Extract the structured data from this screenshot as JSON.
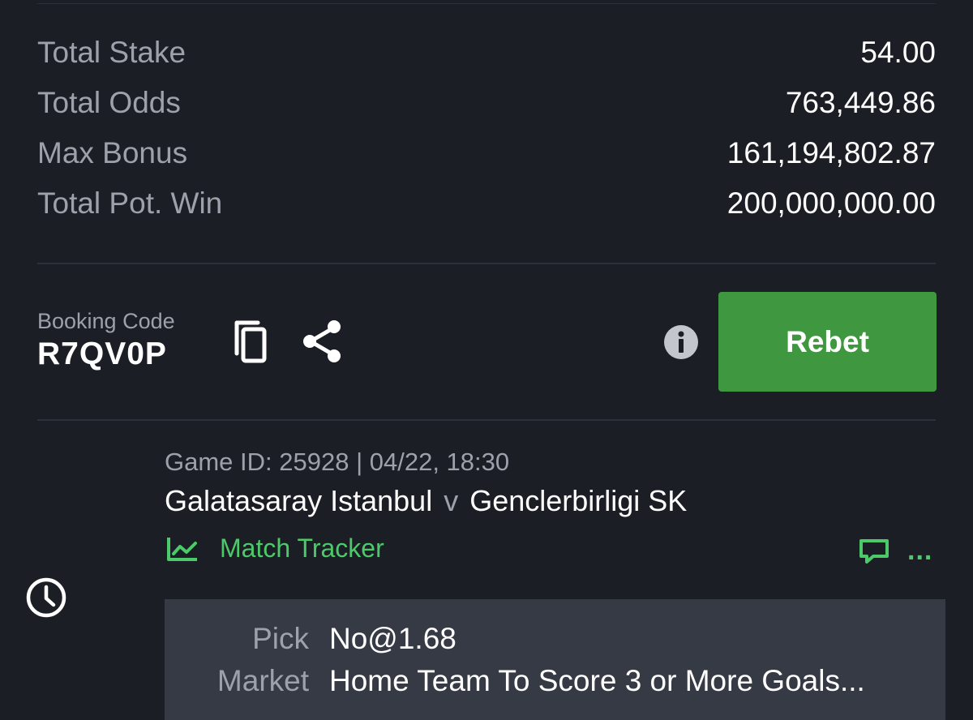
{
  "summary": {
    "rows": [
      {
        "label": "Total Stake",
        "value": "54.00"
      },
      {
        "label": "Total Odds",
        "value": "763,449.86"
      },
      {
        "label": "Max Bonus",
        "value": "161,194,802.87"
      },
      {
        "label": "Total Pot. Win",
        "value": "200,000,000.00"
      }
    ]
  },
  "booking": {
    "label": "Booking Code",
    "code": "R7QV0P",
    "rebet_label": "Rebet"
  },
  "icons": {
    "copy": "copy-icon",
    "share": "share-icon",
    "info": "info-icon",
    "clock": "clock-icon",
    "tracker": "line-chart-icon",
    "comment": "comment-icon",
    "more": "more-icon"
  },
  "game": {
    "meta": "Game ID: 25928 | 04/22, 18:30",
    "home_team": "Galatasaray Istanbul",
    "vs": "v",
    "away_team": "Genclerbirligi SK",
    "tracker_label": "Match Tracker",
    "more_label": "..."
  },
  "details": {
    "pick_label": "Pick",
    "pick_value": "No@1.68",
    "market_label": "Market",
    "market_value": "Home Team To Score 3 or More Goals..."
  },
  "colors": {
    "background": "#1b1e24",
    "accent_green": "#3f973f",
    "tracker_green": "#4cca6a",
    "muted_text": "#9ca1ab",
    "detail_panel": "#353a45"
  }
}
